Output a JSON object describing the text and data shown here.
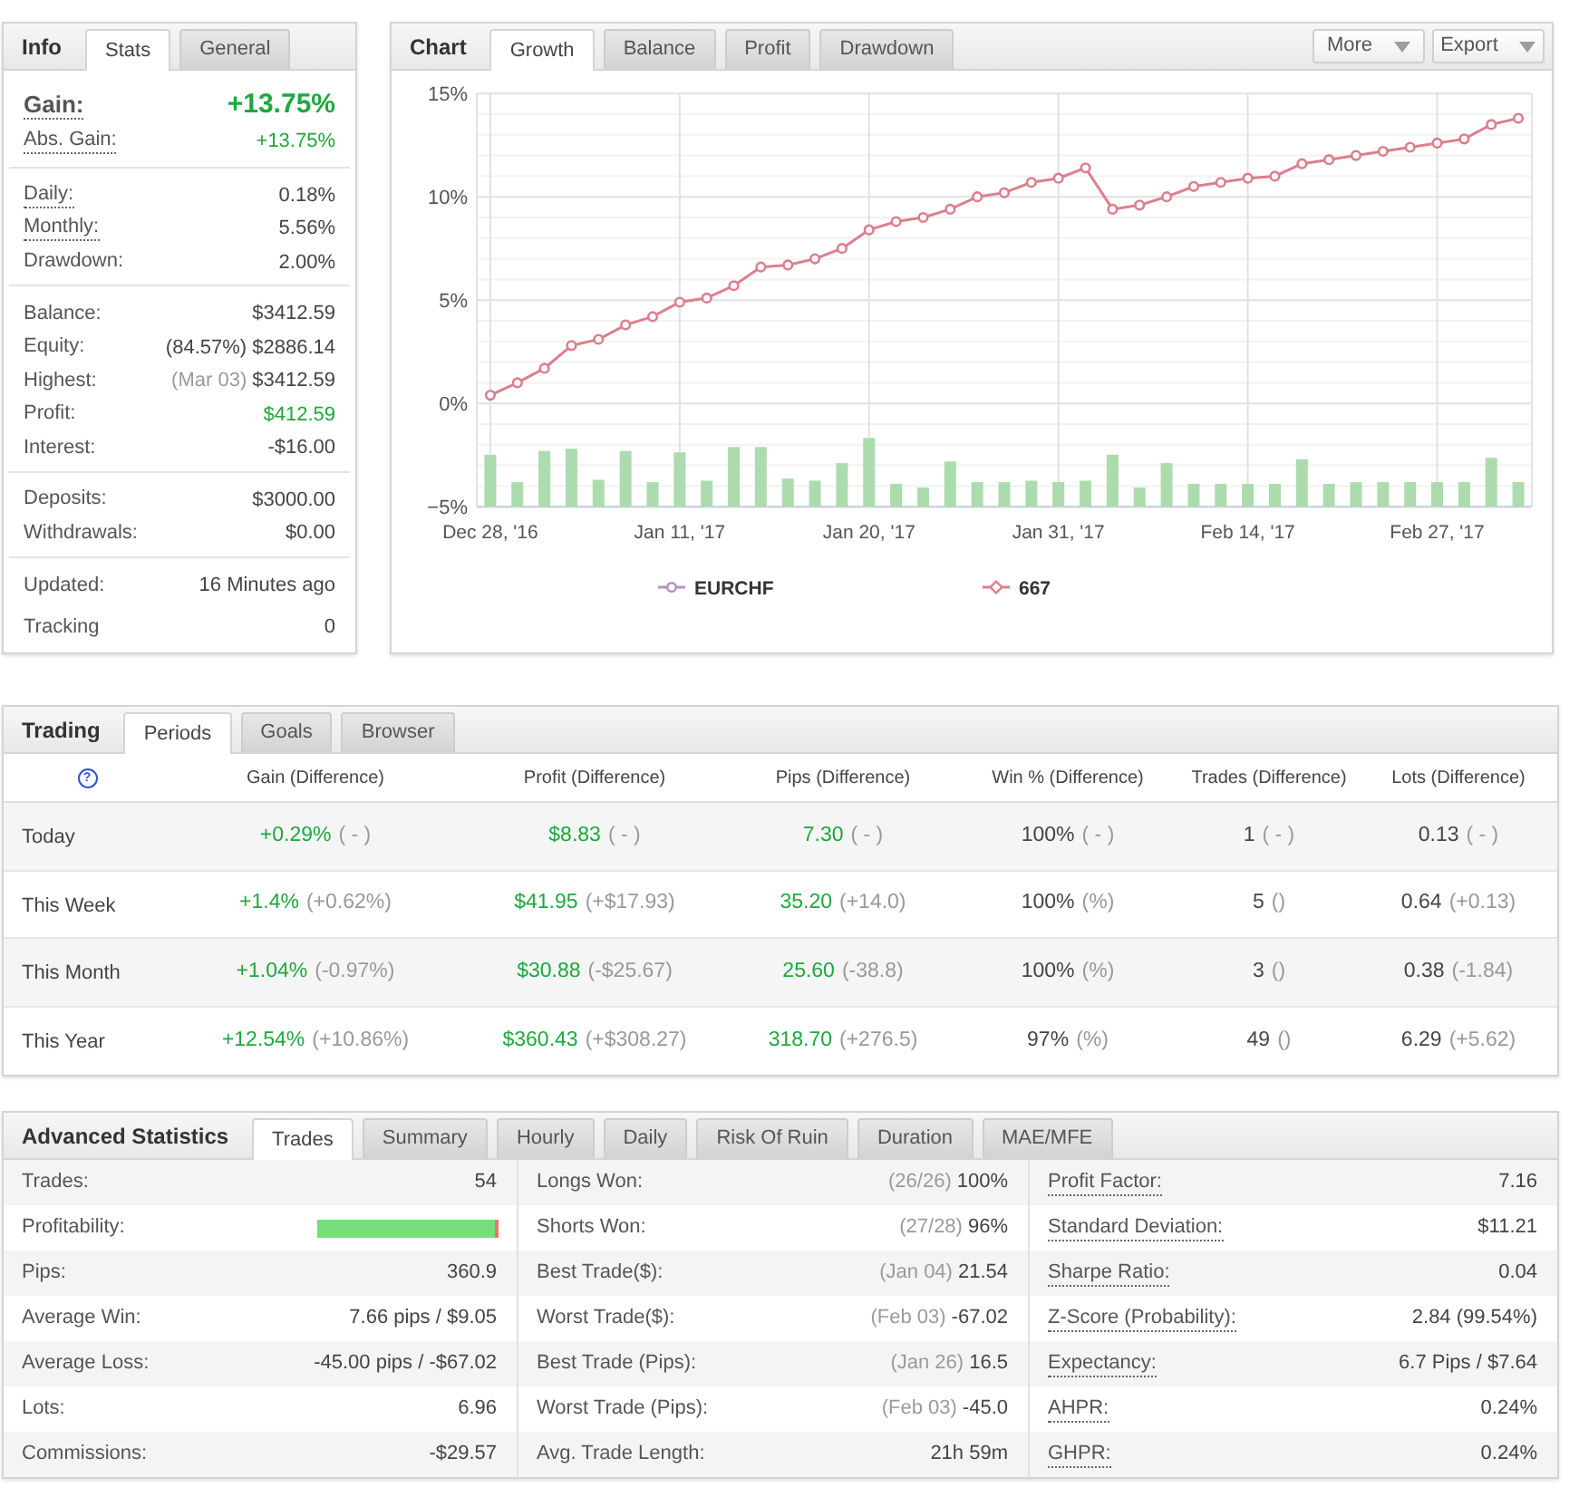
{
  "info_panel": {
    "title": "Info",
    "tabs": [
      {
        "label": "Stats",
        "selected": true
      },
      {
        "label": "General",
        "selected": false
      }
    ],
    "groups": [
      {
        "rows": [
          {
            "kind": "headline",
            "label": "Gain:",
            "value": "+13.75%",
            "color": "#1ea83c",
            "tooltip": true
          },
          {
            "kind": "row",
            "label": "Abs. Gain:",
            "value": "+13.75%",
            "color": "#1ea83c",
            "tooltip": true
          }
        ]
      },
      {
        "rows": [
          {
            "kind": "row",
            "label": "Daily:",
            "value": "0.18%",
            "color": "#444444",
            "tooltip": true
          },
          {
            "kind": "row",
            "label": "Monthly:",
            "value": "5.56%",
            "color": "#444444",
            "tooltip": true
          },
          {
            "kind": "row",
            "label": "Drawdown:",
            "value": "2.00%",
            "color": "#444444",
            "tooltip": false
          }
        ]
      },
      {
        "rows": [
          {
            "kind": "row",
            "label": "Balance:",
            "value": "$3412.59",
            "color": "#444444",
            "tooltip": false
          },
          {
            "kind": "row",
            "label": "Equity:",
            "value": "(84.57%) $2886.14",
            "color": "#444444",
            "tooltip": false
          },
          {
            "kind": "row",
            "label": "Highest:",
            "note": "(Mar 03)",
            "value": "$3412.59",
            "color": "#444444",
            "tooltip": false
          },
          {
            "kind": "row",
            "label": "Profit:",
            "value": "$412.59",
            "color": "#1ea83c",
            "tooltip": false
          },
          {
            "kind": "row",
            "label": "Interest:",
            "value": "-$16.00",
            "color": "#444444",
            "tooltip": false
          }
        ]
      },
      {
        "rows": [
          {
            "kind": "row",
            "label": "Deposits:",
            "value": "$3000.00",
            "color": "#444444",
            "tooltip": false
          },
          {
            "kind": "row",
            "label": "Withdrawals:",
            "value": "$0.00",
            "color": "#444444",
            "tooltip": false
          }
        ]
      },
      {
        "rows": [
          {
            "kind": "row",
            "label": "Updated:",
            "value": "16 Minutes ago",
            "color": "#444444",
            "tooltip": false
          },
          {
            "kind": "row",
            "label": "Tracking",
            "value": "0",
            "color": "#444444",
            "tooltip": false
          }
        ]
      }
    ]
  },
  "chart_panel": {
    "title": "Chart",
    "tabs": [
      {
        "label": "Growth",
        "selected": true
      },
      {
        "label": "Balance",
        "selected": false
      },
      {
        "label": "Profit",
        "selected": false
      },
      {
        "label": "Drawdown",
        "selected": false
      }
    ],
    "buttons": [
      "More",
      "Export"
    ],
    "chart_data": {
      "type": "line",
      "grid": true,
      "ylim": [
        -5,
        15
      ],
      "categories": [
        "Dec 28, '16",
        null,
        null,
        null,
        null,
        null,
        null,
        "Jan 11, '17",
        null,
        null,
        null,
        null,
        null,
        null,
        "Jan 20, '17",
        null,
        null,
        null,
        null,
        null,
        null,
        "Jan 31, '17",
        null,
        null,
        null,
        null,
        null,
        null,
        "Feb 14, '17",
        null,
        null,
        null,
        null,
        null,
        null,
        "Feb 27, '17",
        null,
        null,
        null
      ],
      "yticks": [
        {
          "value": 15,
          "label": "15%"
        },
        {
          "value": 10,
          "label": "10%"
        },
        {
          "value": 5,
          "label": "5%"
        },
        {
          "value": 0,
          "label": "0%"
        },
        {
          "value": -5,
          "label": "−5%"
        }
      ],
      "series": [
        {
          "name": "EURCHF",
          "color": "#b98fc8",
          "values": [
            null,
            null,
            null,
            null,
            null,
            null,
            null,
            null,
            null,
            null,
            null,
            null,
            null,
            null,
            null,
            null,
            null,
            null,
            null,
            null,
            null,
            null,
            null,
            null,
            null,
            null,
            null,
            null,
            null,
            null,
            null,
            null,
            null,
            null,
            null,
            null,
            null,
            null,
            null
          ]
        },
        {
          "name": "667",
          "color": "#dc7f8e",
          "marker": "circle",
          "values": [
            0.4,
            1.0,
            1.7,
            2.8,
            3.1,
            3.8,
            4.2,
            4.9,
            5.1,
            5.7,
            6.6,
            6.7,
            7.0,
            7.5,
            8.4,
            8.8,
            9.0,
            9.4,
            10.0,
            10.2,
            10.7,
            10.9,
            11.4,
            9.4,
            9.6,
            10.0,
            10.5,
            10.7,
            10.9,
            11.0,
            11.6,
            11.8,
            12.0,
            12.2,
            12.4,
            12.6,
            12.8,
            13.5,
            13.8
          ]
        }
      ]
    },
    "legend": [
      {
        "kind": "circle"
      },
      {
        "kind": "diamond"
      }
    ]
  },
  "trading_panel": {
    "title": "Trading",
    "tabs": [
      {
        "label": "Periods",
        "selected": true
      },
      {
        "label": "Goals",
        "selected": false
      },
      {
        "label": "Browser",
        "selected": false
      }
    ],
    "help_label": "?",
    "columns": [
      "Gain (Difference)",
      "Profit (Difference)",
      "Pips (Difference)",
      "Win % (Difference)",
      "Trades (Difference)",
      "Lots (Difference)"
    ],
    "rows": [
      {
        "period": "Today",
        "cells": [
          {
            "value": "+0.29%",
            "color": "#1ea83c",
            "diff": "( - )"
          },
          {
            "value": "$8.83",
            "color": "#1ea83c",
            "diff": "( - )"
          },
          {
            "value": "7.30",
            "color": "#1ea83c",
            "diff": "( - )"
          },
          {
            "value": "100%",
            "color": "#444444",
            "diff": "( - )"
          },
          {
            "value": "1",
            "color": "#444444",
            "diff": "( - )"
          },
          {
            "value": "0.13",
            "color": "#444444",
            "diff": "( - )"
          }
        ]
      },
      {
        "period": "This Week",
        "cells": [
          {
            "value": "+1.4%",
            "color": "#1ea83c",
            "diff": "(+0.62%)"
          },
          {
            "value": "$41.95",
            "color": "#1ea83c",
            "diff": "(+$17.93)"
          },
          {
            "value": "35.20",
            "color": "#1ea83c",
            "diff": "(+14.0)"
          },
          {
            "value": "100%",
            "color": "#444444",
            "diff": "(%)"
          },
          {
            "value": "5",
            "color": "#444444",
            "diff": "()"
          },
          {
            "value": "0.64",
            "color": "#444444",
            "diff": "(+0.13)"
          }
        ]
      },
      {
        "period": "This Month",
        "cells": [
          {
            "value": "+1.04%",
            "color": "#1ea83c",
            "diff": "(-0.97%)"
          },
          {
            "value": "$30.88",
            "color": "#1ea83c",
            "diff": "(-$25.67)"
          },
          {
            "value": "25.60",
            "color": "#1ea83c",
            "diff": "(-38.8)"
          },
          {
            "value": "100%",
            "color": "#444444",
            "diff": "(%)"
          },
          {
            "value": "3",
            "color": "#444444",
            "diff": "()"
          },
          {
            "value": "0.38",
            "color": "#444444",
            "diff": "(-1.84)"
          }
        ]
      },
      {
        "period": "This Year",
        "cells": [
          {
            "value": "+12.54%",
            "color": "#1ea83c",
            "diff": "(+10.86%)"
          },
          {
            "value": "$360.43",
            "color": "#1ea83c",
            "diff": "(+$308.27)"
          },
          {
            "value": "318.70",
            "color": "#1ea83c",
            "diff": "(+276.5)"
          },
          {
            "value": "97%",
            "color": "#444444",
            "diff": "(%)"
          },
          {
            "value": "49",
            "color": "#444444",
            "diff": "()"
          },
          {
            "value": "6.29",
            "color": "#444444",
            "diff": "(+5.62)"
          }
        ]
      }
    ]
  },
  "advanced_panel": {
    "title": "Advanced Statistics",
    "tabs": [
      {
        "label": "Trades",
        "selected": true
      },
      {
        "label": "Summary",
        "selected": false
      },
      {
        "label": "Hourly",
        "selected": false
      },
      {
        "label": "Daily",
        "selected": false
      },
      {
        "label": "Risk Of Ruin",
        "selected": false
      },
      {
        "label": "Duration",
        "selected": false
      },
      {
        "label": "MAE/MFE",
        "selected": false
      }
    ],
    "columns": [
      {
        "rows": [
          {
            "kind": "text",
            "label": "Trades:",
            "value": "54",
            "tooltip": false
          },
          {
            "kind": "bar",
            "label": "Profitability:",
            "level": 0.98,
            "tooltip": false
          },
          {
            "kind": "text",
            "label": "Pips:",
            "value": "360.9",
            "tooltip": false
          },
          {
            "kind": "text",
            "label": "Average Win:",
            "value": "7.66 pips / $9.05",
            "tooltip": false
          },
          {
            "kind": "text",
            "label": "Average Loss:",
            "value": "-45.00 pips / -$67.02",
            "tooltip": false
          },
          {
            "kind": "text",
            "label": "Lots:",
            "value": "6.96",
            "tooltip": false
          },
          {
            "kind": "text",
            "label": "Commissions:",
            "value": "-$29.57",
            "tooltip": false
          }
        ]
      },
      {
        "rows": [
          {
            "kind": "text",
            "label": "Longs Won:",
            "note": "(26/26)",
            "value": "100%",
            "tooltip": false
          },
          {
            "kind": "text",
            "label": "Shorts Won:",
            "note": "(27/28)",
            "value": "96%",
            "tooltip": false
          },
          {
            "kind": "text",
            "label": "Best Trade($):",
            "note": "(Jan 04)",
            "value": "21.54",
            "tooltip": false
          },
          {
            "kind": "text",
            "label": "Worst Trade($):",
            "note": "(Feb 03)",
            "value": "-67.02",
            "tooltip": false
          },
          {
            "kind": "text",
            "label": "Best Trade (Pips):",
            "note": "(Jan 26)",
            "value": "16.5",
            "tooltip": false
          },
          {
            "kind": "text",
            "label": "Worst Trade (Pips):",
            "note": "(Feb 03)",
            "value": "-45.0",
            "tooltip": false
          },
          {
            "kind": "text",
            "label": "Avg. Trade Length:",
            "value": "21h 59m",
            "tooltip": false
          }
        ]
      },
      {
        "rows": [
          {
            "kind": "text",
            "label": "Profit Factor:",
            "value": "7.16",
            "tooltip": true
          },
          {
            "kind": "text",
            "label": "Standard Deviation:",
            "value": "$11.21",
            "tooltip": true
          },
          {
            "kind": "text",
            "label": "Sharpe Ratio:",
            "value": "0.04",
            "tooltip": true
          },
          {
            "kind": "text",
            "label": "Z-Score (Probability):",
            "value": "2.84 (99.54%)",
            "tooltip": true
          },
          {
            "kind": "text",
            "label": "Expectancy:",
            "value": "6.7 Pips / $7.64",
            "tooltip": true
          },
          {
            "kind": "text",
            "label": "AHPR:",
            "value": "0.24%",
            "tooltip": true
          },
          {
            "kind": "text",
            "label": "GHPR:",
            "value": "0.24%",
            "tooltip": true
          }
        ]
      }
    ]
  }
}
